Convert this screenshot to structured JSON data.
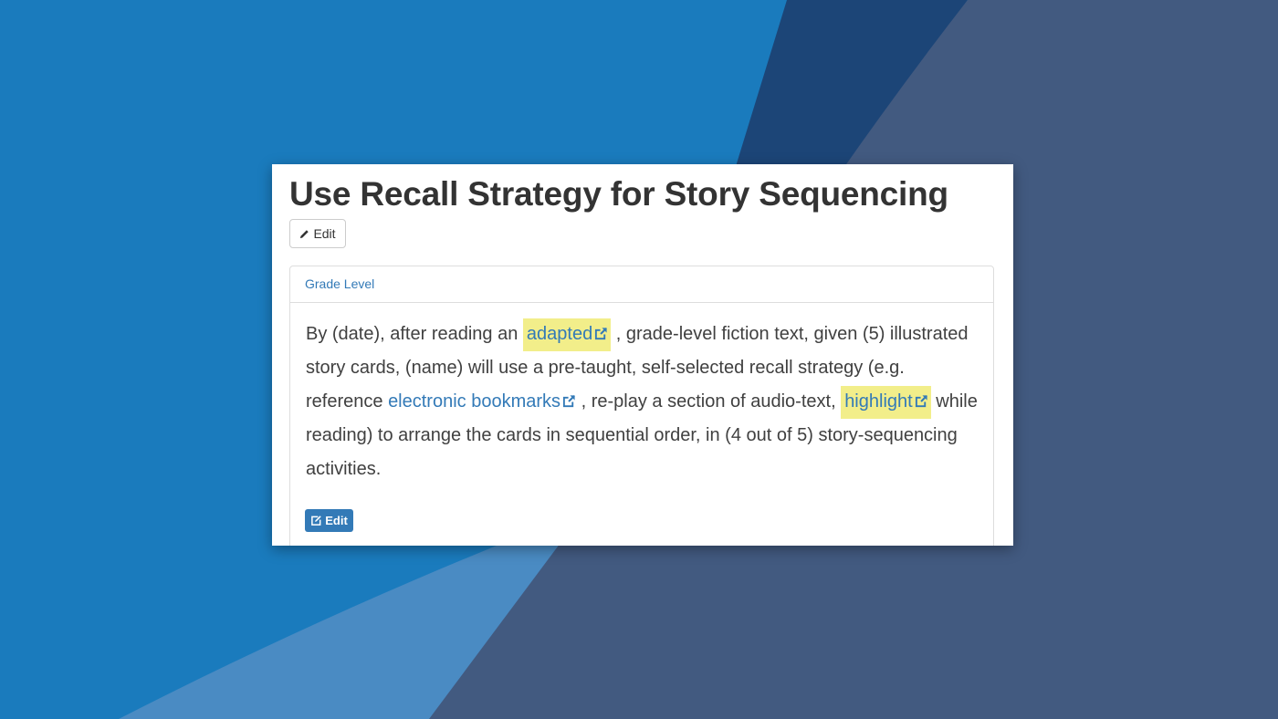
{
  "page": {
    "title": "Use Recall Strategy for Story Sequencing",
    "edit_label": "Edit"
  },
  "panel": {
    "heading": "Grade Level",
    "edit_label": "Edit",
    "body": {
      "t1": "By (date), after reading an ",
      "link1": "adapted",
      "t2": " , grade-level fiction text, given (5) illustrated story cards, (name) will use a pre-taught, self-selected recall strategy (e.g. reference ",
      "link2": "electronic bookmarks",
      "t3": " , re-play a section of audio-text, ",
      "link3": "highlight",
      "t4": " while reading) to arrange the cards in sequential order, in (4 out of 5) story-sequencing activities."
    }
  },
  "colors": {
    "background_main": "#1a7bbd",
    "background_dark": "#1c4577",
    "background_slate": "#425a80",
    "background_light": "#4a8bc3",
    "link": "#337ab7",
    "highlight": "#f2ee8a",
    "primary_button": "#337ab7"
  },
  "icons": {
    "top_edit": "pencil-icon",
    "bottom_edit": "edit-square-icon",
    "links": "external-link-icon"
  }
}
